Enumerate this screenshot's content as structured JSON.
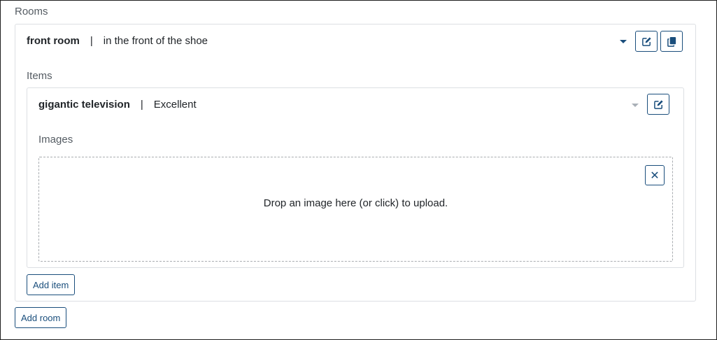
{
  "rooms": {
    "label": "Rooms",
    "room": {
      "name": "front room",
      "separator": "|",
      "description": "in the front of the shoe",
      "items_label": "Items",
      "item": {
        "name": "gigantic television",
        "separator": "|",
        "condition": "Excellent",
        "images_label": "Images",
        "dropzone_text": "Drop an image here (or click) to upload.",
        "close_symbol": "✕"
      },
      "add_item_label": "Add item"
    },
    "add_room_label": "Add room"
  },
  "colors": {
    "accent": "#1a4e7c",
    "border": "#dcdfe3",
    "label": "#555c63"
  }
}
